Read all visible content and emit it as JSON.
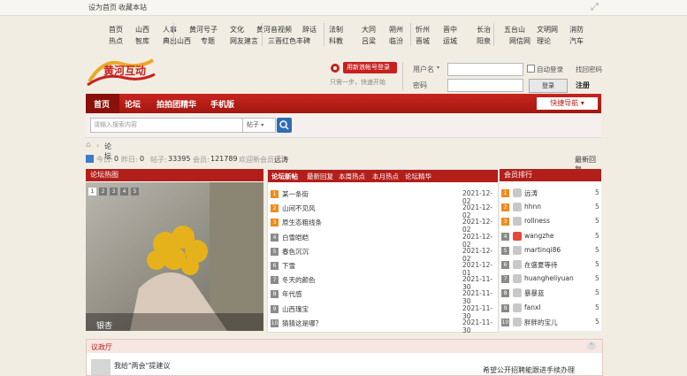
{
  "topbar": {
    "set_home": "设为首页",
    "bookmark": "收藏本站"
  },
  "nav": {
    "row1": [
      "首页",
      "山西",
      "人事",
      "黄河号子",
      "文化",
      "黄河音视频",
      "辞话",
      "法制",
      "大同",
      "朔州",
      "忻州",
      "晋中",
      "长治",
      "五台山",
      "文明网",
      "消防"
    ],
    "row2": [
      "热点",
      "智库",
      "典出山西",
      "专题",
      "网友建言",
      "三晋红色丰碑",
      "科教",
      "吕梁",
      "临汾",
      "晋城",
      "运城",
      "阳泉",
      "网信网",
      "理论",
      "汽车"
    ]
  },
  "logo": {
    "text": "黄河互动"
  },
  "login": {
    "weibo_button": "用新浪帐号登录",
    "hint": "只需一步，快速开始",
    "username_select": "用户名",
    "auto_login": "自动登录",
    "forgot": "找回密码",
    "password_label": "密码",
    "login_button": "登录",
    "register": "注册"
  },
  "mainnav": {
    "items": [
      "首页",
      "论坛",
      "拍拍团精华",
      "手机版"
    ],
    "quick": "快捷导航"
  },
  "search": {
    "placeholder": "请输入搜索内容",
    "scope": "帖子"
  },
  "breadcrumb": {
    "current": "论坛"
  },
  "stats": {
    "today_label": "今日:",
    "today": "0",
    "yesterday_label": "昨日:",
    "yesterday": "0",
    "posts_label": "帖子:",
    "posts": "33395",
    "members_label": "会员:",
    "members": "121789",
    "welcome_label": "欢迎新会员:",
    "welcome_user": "远涛",
    "latest": "最新回复"
  },
  "hot": {
    "title": "论坛热图",
    "pages": [
      "1",
      "2",
      "3",
      "4",
      "5"
    ],
    "caption": "银杏"
  },
  "threads": {
    "tabs": [
      "论坛新帖",
      "最新回复",
      "本周热点",
      "本月热点",
      "论坛精华"
    ],
    "rows": [
      {
        "n": "1",
        "title": "某一条街",
        "date": "2021-12-02"
      },
      {
        "n": "2",
        "title": "山间不见风",
        "date": "2021-12-02"
      },
      {
        "n": "3",
        "title": "原生态粗线条",
        "date": "2021-12-02"
      },
      {
        "n": "4",
        "title": "白雪皑皑",
        "date": "2021-12-02"
      },
      {
        "n": "5",
        "title": "春色沉沉",
        "date": "2021-12-02"
      },
      {
        "n": "6",
        "title": "下雪",
        "date": "2021-12-01"
      },
      {
        "n": "7",
        "title": "冬天的颜色",
        "date": "2021-11-30"
      },
      {
        "n": "8",
        "title": "年代感",
        "date": "2021-11-30"
      },
      {
        "n": "9",
        "title": "山西瑰宝",
        "date": "2021-11-30"
      },
      {
        "n": "10",
        "title": "猜猜这是哪？",
        "date": "2021-11-30"
      }
    ]
  },
  "ranking": {
    "title": "会员排行",
    "rows": [
      {
        "n": "1",
        "name": "远涛",
        "c": "5"
      },
      {
        "n": "2",
        "name": "hhnn",
        "c": "5"
      },
      {
        "n": "3",
        "name": "rollness",
        "c": "5"
      },
      {
        "n": "4",
        "name": "wangzhe",
        "c": "5"
      },
      {
        "n": "5",
        "name": "martinqi86",
        "c": "5"
      },
      {
        "n": "6",
        "name": "在盛夏等待",
        "c": "5"
      },
      {
        "n": "7",
        "name": "huangheliyuan",
        "c": "5"
      },
      {
        "n": "8",
        "name": "暴暴蓝",
        "c": "5"
      },
      {
        "n": "9",
        "name": "fanxl",
        "c": "5"
      },
      {
        "n": "10",
        "name": "胖胖的宝儿",
        "c": "5"
      }
    ]
  },
  "bottom": {
    "title": "议政厅",
    "post": "我给\"两会\"提建议",
    "right_post": "希望公开招聘能跟进手续办理"
  },
  "colors": {
    "brand_red": "#b21e1a",
    "accent_blue": "#2e6db5",
    "rank_orange": "#f08b1f"
  }
}
